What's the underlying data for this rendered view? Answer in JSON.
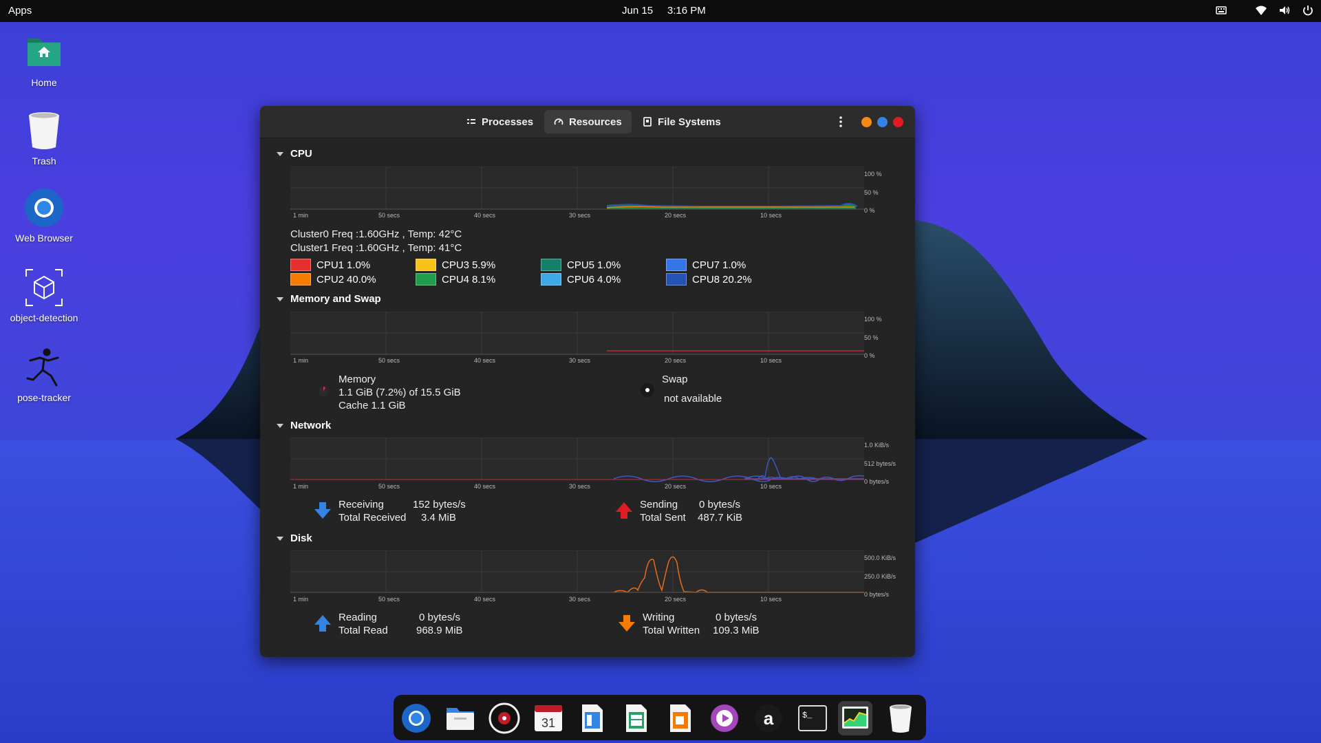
{
  "topbar": {
    "apps_label": "Apps",
    "date": "Jun 15",
    "time": "3:16 PM",
    "tray_icons": [
      "keyboard-icon",
      "wifi-icon",
      "volume-icon",
      "power-icon"
    ]
  },
  "desktop_icons": [
    {
      "label": "Home",
      "icon": "home-folder-icon"
    },
    {
      "label": "Trash",
      "icon": "trash-icon"
    },
    {
      "label": "Web Browser",
      "icon": "browser-icon"
    },
    {
      "label": "object-detection",
      "icon": "cube-icon"
    },
    {
      "label": "pose-tracker",
      "icon": "running-figure-icon"
    }
  ],
  "window": {
    "tabs": [
      {
        "label": "Processes",
        "icon": "list-icon"
      },
      {
        "label": "Resources",
        "icon": "gauge-icon",
        "active": true
      },
      {
        "label": "File Systems",
        "icon": "disk-icon"
      }
    ],
    "controls_colors": [
      "#f58a17",
      "#3584e4",
      "#e01b24"
    ]
  },
  "time_ticks": [
    "1 min",
    "50 secs",
    "40 secs",
    "30 secs",
    "20 secs",
    "10 secs"
  ],
  "cpu": {
    "title": "CPU",
    "y_ticks": [
      "100 %",
      "50 %",
      "0 %"
    ],
    "cluster0": "Cluster0 Freq :1.60GHz , Temp: 42°C",
    "cluster1": "Cluster1 Freq :1.60GHz , Temp: 41°C",
    "cores": [
      {
        "name": "CPU1",
        "value": "1.0%",
        "color": "#e5302f"
      },
      {
        "name": "CPU2",
        "value": "40.0%",
        "color": "#f57c00"
      },
      {
        "name": "CPU3",
        "value": "5.9%",
        "color": "#f8c21b"
      },
      {
        "name": "CPU4",
        "value": "8.1%",
        "color": "#1e9e4a"
      },
      {
        "name": "CPU5",
        "value": "1.0%",
        "color": "#14806a"
      },
      {
        "name": "CPU6",
        "value": "4.0%",
        "color": "#3fa8e6"
      },
      {
        "name": "CPU7",
        "value": "1.0%",
        "color": "#3575e8"
      },
      {
        "name": "CPU8",
        "value": "20.2%",
        "color": "#2553b5"
      }
    ]
  },
  "memory": {
    "title": "Memory and Swap",
    "y_ticks": [
      "100 %",
      "50 %",
      "0 %"
    ],
    "memory_label": "Memory",
    "memory_value": "1.1 GiB (7.2%) of 15.5 GiB",
    "cache": "Cache 1.1 GiB",
    "swap_label": "Swap",
    "swap_value": "not available"
  },
  "network": {
    "title": "Network",
    "y_ticks": [
      "1.0 KiB/s",
      "512 bytes/s",
      "0 bytes/s"
    ],
    "receiving_label": "Receiving",
    "receiving_value": "152 bytes/s",
    "total_received_label": "Total Received",
    "total_received_value": "3.4 MiB",
    "sending_label": "Sending",
    "sending_value": "0 bytes/s",
    "total_sent_label": "Total Sent",
    "total_sent_value": "487.7 KiB"
  },
  "disk": {
    "title": "Disk",
    "y_ticks": [
      "500.0 KiB/s",
      "250.0 KiB/s",
      "0 bytes/s"
    ],
    "reading_label": "Reading",
    "reading_value": "0 bytes/s",
    "total_read_label": "Total Read",
    "total_read_value": "968.9 MiB",
    "writing_label": "Writing",
    "writing_value": "0 bytes/s",
    "total_written_label": "Total Written",
    "total_written_value": "109.3 MiB"
  },
  "dock": {
    "apps": [
      "browser-icon",
      "files-icon",
      "music-player-icon",
      "calendar-icon",
      "document-icon",
      "spreadsheet-icon",
      "presentation-icon",
      "video-player-icon",
      "store-icon",
      "terminal-icon",
      "system-monitor-icon",
      "trash-icon"
    ],
    "calendar_day": "31",
    "active_app": "system-monitor-icon"
  }
}
